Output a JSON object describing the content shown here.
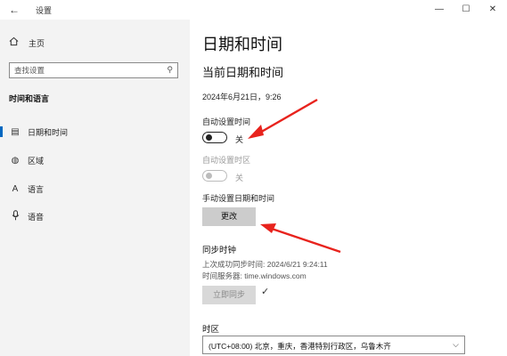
{
  "window": {
    "title": "设置",
    "back_icon": "←",
    "min_icon": "—",
    "max_icon": "☐",
    "close_icon": "✕"
  },
  "sidebar": {
    "home_label": "主页",
    "search_placeholder": "查找设置",
    "section_title": "时间和语言",
    "items": [
      {
        "icon": "calendar-icon",
        "glyph": "▤",
        "label": "日期和时间",
        "active": true
      },
      {
        "icon": "region-icon",
        "glyph": "◍",
        "label": "区域",
        "active": false
      },
      {
        "icon": "language-icon",
        "glyph": "A",
        "label": "语言",
        "active": false
      },
      {
        "icon": "microphone-icon",
        "glyph": "🎙",
        "label": "语音",
        "active": false
      }
    ]
  },
  "main": {
    "page_title": "日期和时间",
    "section_title": "当前日期和时间",
    "current_datetime": "2024年6月21日，9:26",
    "auto_time": {
      "label": "自动设置时间",
      "state": "关",
      "on": false
    },
    "auto_timezone": {
      "label": "自动设置时区",
      "state": "关",
      "on": false,
      "disabled": true
    },
    "manual": {
      "label": "手动设置日期和时间",
      "button": "更改"
    },
    "sync": {
      "title": "同步时钟",
      "last_sync": "上次成功同步时间: 2024/6/21 9:24:11",
      "server": "时间服务器: time.windows.com",
      "button": "立即同步",
      "check_glyph": "✓"
    },
    "timezone": {
      "label": "时区",
      "value": "(UTC+08:00) 北京，重庆，香港特别行政区，乌鲁木齐",
      "chevron": "⌵"
    }
  },
  "colors": {
    "accent": "#0067c0",
    "annotation_arrow": "#e8231d",
    "sidebar_bg": "#f3f3f3"
  }
}
